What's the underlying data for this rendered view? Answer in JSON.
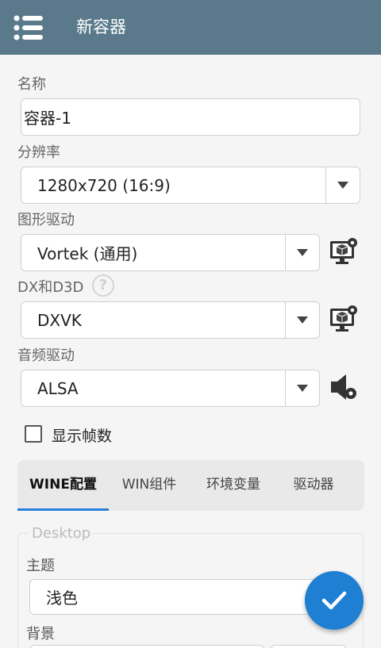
{
  "appbar": {
    "title": "新容器",
    "menu_icon": "menu-icon"
  },
  "form": {
    "name": {
      "label": "名称",
      "value": "容器-1"
    },
    "resolution": {
      "label": "分辨率",
      "value": "1280x720 (16:9)"
    },
    "graphics_driver": {
      "label": "图形驱动",
      "value": "Vortek (通用)",
      "settings_icon": "gpu-settings-icon"
    },
    "dx": {
      "label": "DX和D3D",
      "help": "?",
      "value": "DXVK",
      "settings_icon": "dx-settings-icon"
    },
    "audio_driver": {
      "label": "音频驱动",
      "value": "ALSA",
      "settings_icon": "audio-settings-icon"
    },
    "show_fps": {
      "label": "显示帧数",
      "checked": false
    }
  },
  "tabs": [
    {
      "label": "WINE配置",
      "active": true
    },
    {
      "label": "WIN组件",
      "active": false
    },
    {
      "label": "环境变量",
      "active": false
    },
    {
      "label": "驱动器",
      "active": false
    }
  ],
  "desktop": {
    "legend": "Desktop",
    "theme": {
      "label": "主题",
      "value": "浅色"
    },
    "background": {
      "label": "背景"
    }
  },
  "fab": {
    "icon": "check-icon"
  },
  "colors": {
    "appbar": "#5a7a8c",
    "accent": "#1e7fd3",
    "background": "#f5f5f5"
  }
}
